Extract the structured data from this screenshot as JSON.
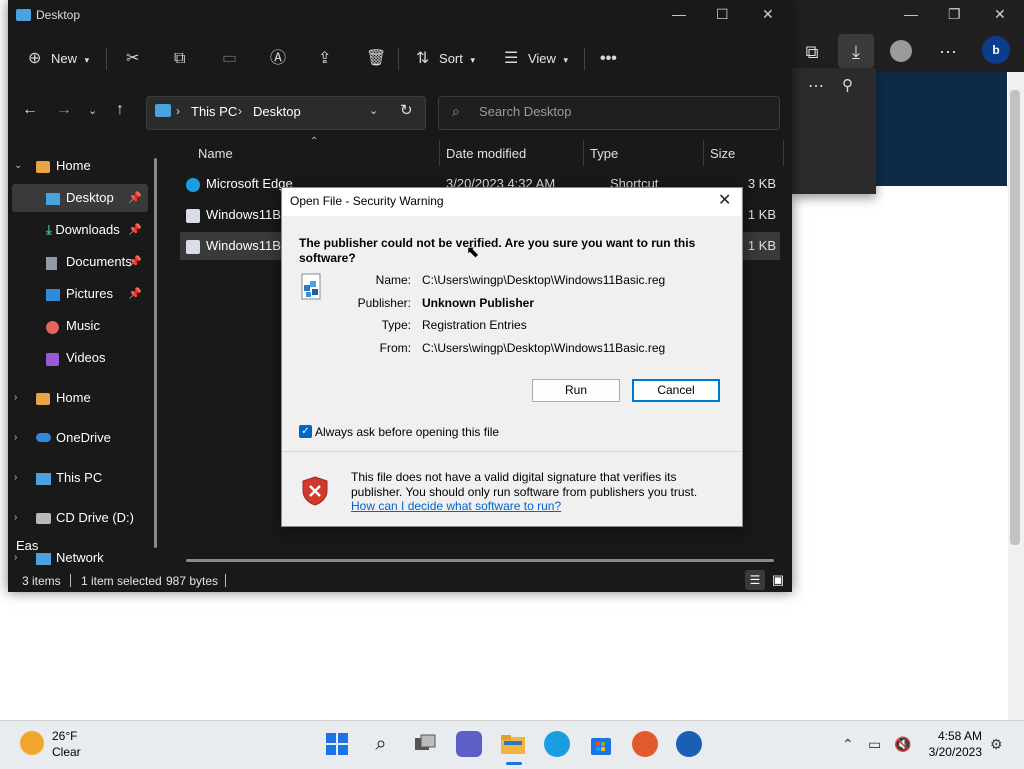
{
  "explorer": {
    "title": "Desktop",
    "toolbar": {
      "new_label": "New",
      "sort_label": "Sort",
      "view_label": "View"
    },
    "address": {
      "root": "This PC",
      "folder": "Desktop"
    },
    "search_placeholder": "Search Desktop",
    "sidebar": [
      {
        "label": "Home",
        "icon": "home-icon"
      },
      {
        "label": "Desktop",
        "icon": "desktop-icon"
      },
      {
        "label": "Downloads",
        "icon": "download-icon"
      },
      {
        "label": "Documents",
        "icon": "document-icon"
      },
      {
        "label": "Pictures",
        "icon": "pictures-icon"
      },
      {
        "label": "Music",
        "icon": "music-icon"
      },
      {
        "label": "Videos",
        "icon": "videos-icon"
      },
      {
        "label": "Home",
        "icon": "home-icon"
      },
      {
        "label": "OneDrive",
        "icon": "cloud-icon"
      },
      {
        "label": "This PC",
        "icon": "computer-icon"
      },
      {
        "label": "CD Drive (D:) Eas",
        "icon": "cd-drive-icon"
      },
      {
        "label": "Network",
        "icon": "network-icon"
      }
    ],
    "columns": {
      "name": "Name",
      "date": "Date modified",
      "type": "Type",
      "size": "Size"
    },
    "rows": [
      {
        "name": "Microsoft Edge",
        "date": "3/20/2023 4:32 AM",
        "type": "Shortcut",
        "size": "3 KB"
      },
      {
        "name": "Windows11Ba",
        "size": "1 KB"
      },
      {
        "name": "Windows11Ba",
        "size": "1 KB"
      }
    ],
    "status": {
      "items": "3 items",
      "selected": "1 item selected",
      "bytes": "987 bytes"
    }
  },
  "dialog": {
    "title": "Open File - Security Warning",
    "question": "The publisher could not be verified.  Are you sure you want to run this software?",
    "fields": [
      {
        "key": "Name:",
        "value": "C:\\Users\\wingp\\Desktop\\Windows11Basic.reg",
        "bold": false
      },
      {
        "key": "Publisher:",
        "value": "Unknown Publisher",
        "bold": true
      },
      {
        "key": "Type:",
        "value": "Registration Entries",
        "bold": false
      },
      {
        "key": "From:",
        "value": "C:\\Users\\wingp\\Desktop\\Windows11Basic.reg",
        "bold": false
      }
    ],
    "run_label": "Run",
    "cancel_label": "Cancel",
    "checkbox_label": "Always ask before opening this file",
    "warning_text": "This file does not have a valid digital signature that verifies its publisher.  You should only run software from publishers you trust.",
    "link_text": "How can I decide what software to run?"
  },
  "taskbar": {
    "weather_temp": "26°F",
    "weather_cond": "Clear",
    "time": "4:58 AM",
    "date": "3/20/2023"
  },
  "colors": {
    "accent": "#0067c0",
    "explorer_bg": "#191919",
    "dialog_bg": "#f0f0f0",
    "link": "#0066cc"
  }
}
